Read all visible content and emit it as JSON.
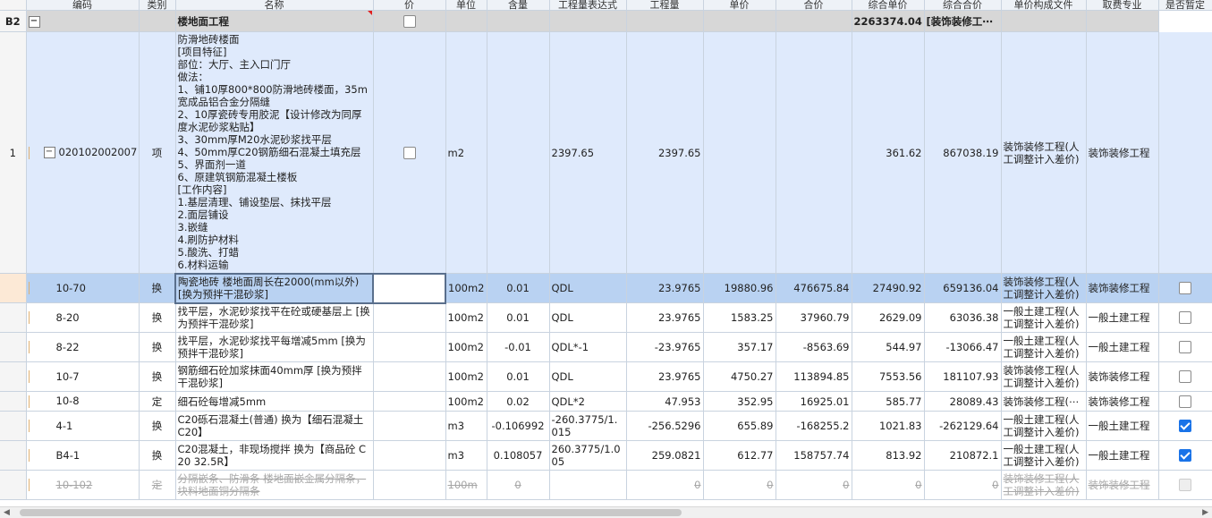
{
  "headers": [
    "编码",
    "类别",
    "名称",
    "价",
    "单位",
    "含量",
    "工程量表达式",
    "工程量",
    "单价",
    "合价",
    "综合单价",
    "综合合价",
    "单价构成文件",
    "取费专业",
    "是否暂定"
  ],
  "group": {
    "idx": "B2",
    "toggle": "−",
    "name": "楼地面工程",
    "total": "2263374.04",
    "fee_file": "[装饰装修工⋯"
  },
  "item": {
    "idx": "1",
    "toggle": "−",
    "code": "020102002007",
    "type": "项",
    "name": "防滑地砖楼面\n[项目特征]\n部位：大厅、主入口门厅\n做法：\n1、铺10厚800*800防滑地砖楼面，35m宽成品铝合金分隔缝\n2、10厚瓷砖专用胶泥【设计修改为同厚度水泥砂浆粘贴】\n3、30mm厚M20水泥砂浆找平层\n4、50mm厚C20钢筋细石混凝土填充层\n5、界面剂一道\n6、原建筑钢筋混凝土楼板\n[工作内容]\n1.基层清理、铺设垫层、抹找平层\n2.面层铺设\n3.嵌缝\n4.刷防护材料\n5.酸洗、打蜡\n6.材料运输",
    "unit": "m2",
    "expr": "2397.65",
    "qty": "2397.65",
    "comp_price": "361.62",
    "comp_total": "867038.19",
    "fee_file": "装饰装修工程(人工调整计入差价)",
    "fee_type": "装饰装修工程"
  },
  "rows": [
    {
      "code": "10-70",
      "type": "换",
      "name": "陶瓷地砖 楼地面周长在2000(mm以外) [换为预拌干混砂浆]",
      "unit": "100m2",
      "content": "0.01",
      "expr": "QDL",
      "qty": "23.9765",
      "price": "19880.96",
      "total": "476675.84",
      "comp_price": "27490.92",
      "comp_total": "659136.04",
      "fee_file": "装饰装修工程(人工调整计入差价)",
      "fee_type": "装饰装修工程",
      "checked": false,
      "style": "sel"
    },
    {
      "code": "8-20",
      "type": "换",
      "name": "找平层，水泥砂浆找平在砼或硬基层上 [换为预拌干混砂浆]",
      "unit": "100m2",
      "content": "0.01",
      "expr": "QDL",
      "qty": "23.9765",
      "price": "1583.25",
      "total": "37960.79",
      "comp_price": "2629.09",
      "comp_total": "63036.38",
      "fee_file": "一般土建工程(人工调整计入差价)",
      "fee_type": "一般土建工程",
      "checked": false,
      "style": "norm"
    },
    {
      "code": "8-22",
      "type": "换",
      "name": "找平层，水泥砂浆找平每增减5mm [换为预拌干混砂浆]",
      "unit": "100m2",
      "content": "-0.01",
      "expr": "QDL*-1",
      "qty": "-23.9765",
      "price": "357.17",
      "total": "-8563.69",
      "comp_price": "544.97",
      "comp_total": "-13066.47",
      "fee_file": "一般土建工程(人工调整计入差价)",
      "fee_type": "一般土建工程",
      "checked": false,
      "style": "norm"
    },
    {
      "code": "10-7",
      "type": "换",
      "name": "钢筋细石砼加浆抹面40mm厚 [换为预拌干混砂浆]",
      "unit": "100m2",
      "content": "0.01",
      "expr": "QDL",
      "qty": "23.9765",
      "price": "4750.27",
      "total": "113894.85",
      "comp_price": "7553.56",
      "comp_total": "181107.93",
      "fee_file": "装饰装修工程(人工调整计入差价)",
      "fee_type": "装饰装修工程",
      "checked": false,
      "style": "norm"
    },
    {
      "code": "10-8",
      "type": "定",
      "name": "细石砼每增减5mm",
      "unit": "100m2",
      "content": "0.02",
      "expr": "QDL*2",
      "qty": "47.953",
      "price": "352.95",
      "total": "16925.01",
      "comp_price": "585.77",
      "comp_total": "28089.43",
      "fee_file": "装饰装修工程(⋯",
      "fee_type": "装饰装修工程",
      "checked": false,
      "style": "norm"
    },
    {
      "code": "4-1",
      "type": "换",
      "name": "C20砾石混凝土(普通) 换为【细石混凝土 C20】",
      "unit": "m3",
      "content": "-0.106992",
      "expr": "-260.3775/1.015",
      "qty": "-256.5296",
      "price": "655.89",
      "total": "-168255.2",
      "comp_price": "1021.83",
      "comp_total": "-262129.64",
      "fee_file": "一般土建工程(人工调整计入差价)",
      "fee_type": "一般土建工程",
      "checked": true,
      "style": "norm"
    },
    {
      "code": "B4-1",
      "type": "换",
      "name": "C20混凝土，非现场搅拌 换为【商品砼 C20 32.5R】",
      "unit": "m3",
      "content": "0.108057",
      "expr": "260.3775/1.005",
      "qty": "259.0821",
      "price": "612.77",
      "total": "158757.74",
      "comp_price": "813.92",
      "comp_total": "210872.1",
      "fee_file": "一般土建工程(人工调整计入差价)",
      "fee_type": "一般土建工程",
      "checked": true,
      "style": "norm"
    },
    {
      "code": "10-102",
      "type": "定",
      "name": "分隔嵌条、防滑条 楼地面嵌金属分隔条，块料地面铜分隔条",
      "unit": "100m",
      "content": "0",
      "expr": "",
      "qty": "0",
      "price": "0",
      "total": "0",
      "comp_price": "0",
      "comp_total": "0",
      "fee_file": "装饰装修工程(人工调整计入差价)",
      "fee_type": "装饰装修工程",
      "checked": false,
      "style": "dis"
    }
  ],
  "scrollbar": {
    "left_arrow": "◀",
    "right_arrow": "▶"
  }
}
